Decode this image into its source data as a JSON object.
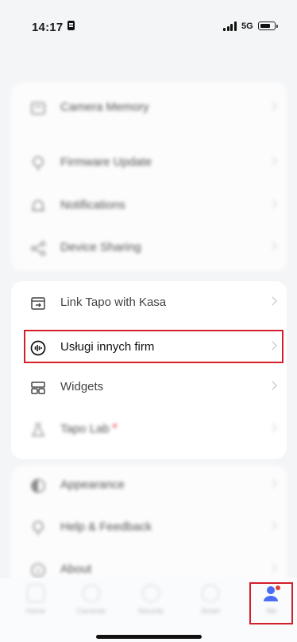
{
  "status_bar": {
    "time": "14:17",
    "network": "5G"
  },
  "card1": {
    "items": [
      {
        "label": "Camera Memory",
        "icon": "memory-icon"
      },
      {
        "label": "Firmware Update",
        "icon": "firmware-icon"
      },
      {
        "label": "Notifications",
        "icon": "bell-icon"
      },
      {
        "label": "Device Sharing",
        "icon": "share-icon"
      }
    ]
  },
  "card2": {
    "items": [
      {
        "label": "Link Tapo with Kasa",
        "icon": "link-kasa-icon"
      },
      {
        "label": "Usługi innych firm",
        "icon": "third-party-services-icon"
      },
      {
        "label": "Widgets",
        "icon": "widgets-icon"
      },
      {
        "label": "Tapo Lab",
        "icon": "lab-icon"
      }
    ]
  },
  "card3": {
    "items": [
      {
        "label": "Appearance",
        "icon": "appearance-icon"
      },
      {
        "label": "Help & Feedback",
        "icon": "help-icon"
      },
      {
        "label": "About",
        "icon": "about-icon"
      }
    ]
  },
  "tabbar": {
    "tabs": [
      {
        "label": "Home"
      },
      {
        "label": "Cameras"
      },
      {
        "label": "Security"
      },
      {
        "label": "Smart"
      },
      {
        "label": "Me"
      }
    ]
  },
  "colors": {
    "highlight": "#d21f2a",
    "accent": "#4a6cf7",
    "badge": "#e3403d"
  }
}
